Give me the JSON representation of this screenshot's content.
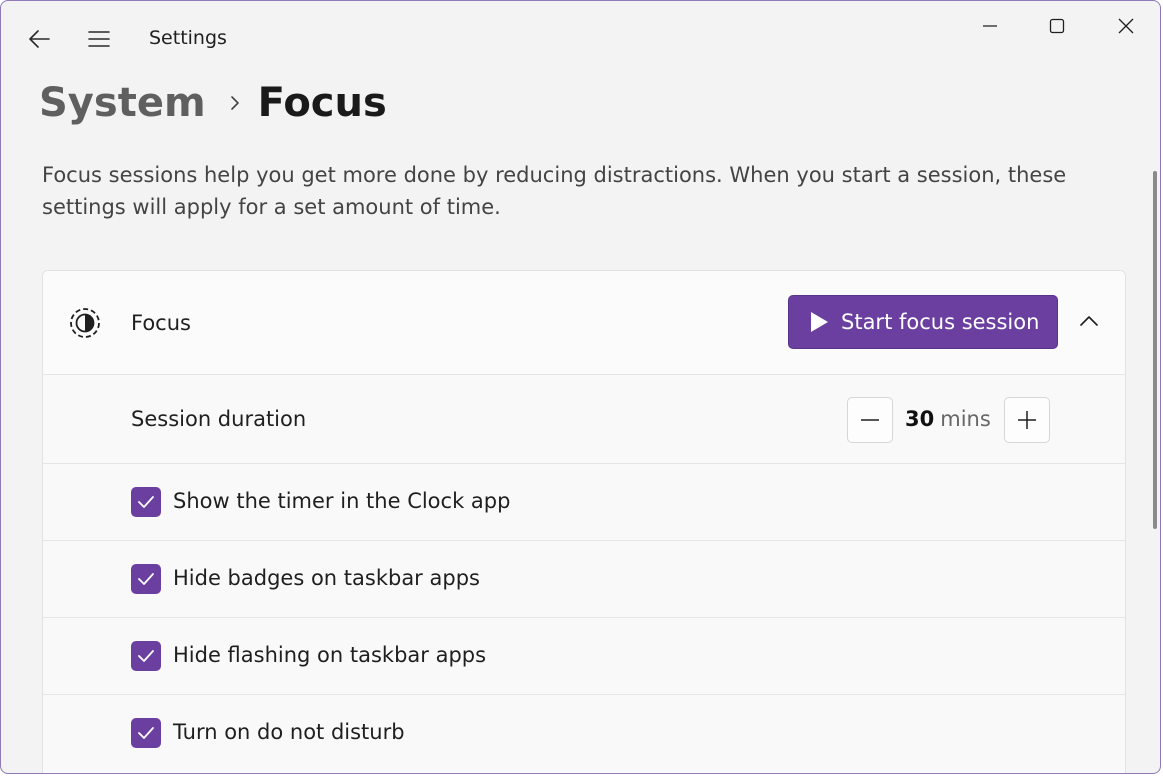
{
  "titlebar": {
    "app_title": "Settings",
    "back_icon": "back-arrow-icon",
    "menu_icon": "hamburger-menu-icon",
    "window_controls": [
      "minimize-icon",
      "maximize-icon",
      "close-icon"
    ]
  },
  "breadcrumb": {
    "parent": "System",
    "current": "Focus"
  },
  "description": "Focus sessions help you get more done by reducing distractions. When you start a session, these settings will apply for a set amount of time.",
  "focus_card": {
    "icon": "focus-timer-icon",
    "label": "Focus",
    "start_button_label": "Start focus session",
    "collapse_icon": "chevron-up-icon",
    "session_duration": {
      "label": "Session duration",
      "value": "30",
      "unit": "mins"
    },
    "options": [
      {
        "label": "Show the timer in the Clock app",
        "checked": true
      },
      {
        "label": "Hide badges on taskbar apps",
        "checked": true
      },
      {
        "label": "Hide flashing on taskbar apps",
        "checked": true
      },
      {
        "label": "Turn on do not disturb",
        "checked": true
      }
    ]
  },
  "colors": {
    "accent": "#6b3fa0",
    "window_bg": "#f3f3f3",
    "card_bg": "#fbfbfb"
  }
}
